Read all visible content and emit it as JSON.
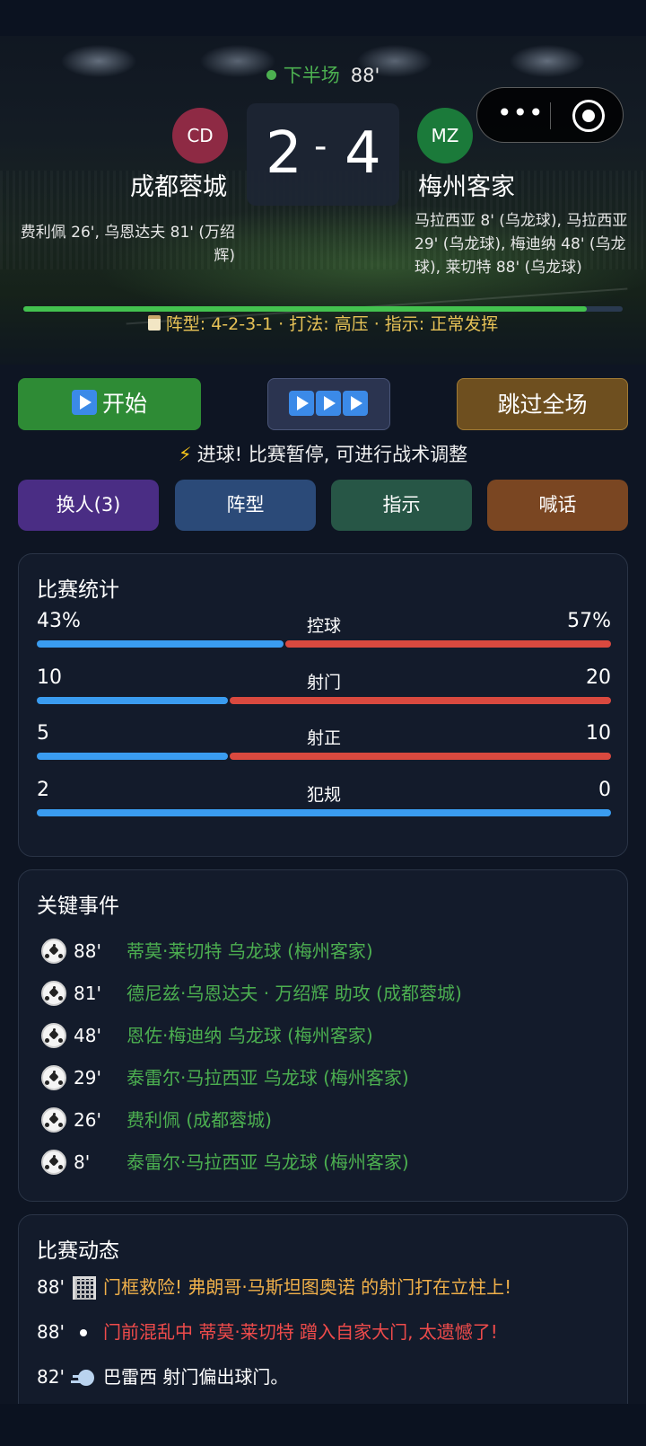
{
  "match": {
    "period_label": "下半场",
    "minute": "88'",
    "home": {
      "abbr": "CD",
      "name": "成都蓉城",
      "score": "2",
      "color": "#8e2a44",
      "scorers": "费利佩 26', 乌恩达夫 81' (万绍辉)"
    },
    "away": {
      "abbr": "MZ",
      "name": "梅州客家",
      "score": "4",
      "color": "#1b7a3a",
      "scorers": "马拉西亚 8' (乌龙球), 马拉西亚 29' (乌龙球), 梅迪纳 48' (乌龙球), 莱切特 88' (乌龙球)"
    },
    "score_separator": "-",
    "progress_fraction": 0.94,
    "tactics": "阵型: 4-2-3-1 · 打法: 高压 · 指示: 正常发挥"
  },
  "controls": {
    "start_label": "开始",
    "skip_label": "跳过全场",
    "notice": "进球! 比赛暂停, 可进行战术调整",
    "tactic_buttons": {
      "sub": "换人(3)",
      "formation": "阵型",
      "instructions": "指示",
      "shout": "喊话"
    }
  },
  "stats": {
    "title": "比赛统计",
    "rows": [
      {
        "name": "控球",
        "home": "43%",
        "away": "57%",
        "home_fraction": 0.43
      },
      {
        "name": "射门",
        "home": "10",
        "away": "20",
        "home_fraction": 0.333
      },
      {
        "name": "射正",
        "home": "5",
        "away": "10",
        "home_fraction": 0.333
      },
      {
        "name": "犯规",
        "home": "2",
        "away": "0",
        "home_fraction": 1.0
      }
    ]
  },
  "events": {
    "title": "关键事件",
    "items": [
      {
        "minute": "88'",
        "text": "蒂莫·莱切特 乌龙球 (梅州客家)"
      },
      {
        "minute": "81'",
        "text": "德尼兹·乌恩达夫 · 万绍辉 助攻 (成都蓉城)"
      },
      {
        "minute": "48'",
        "text": "恩佐·梅迪纳 乌龙球 (梅州客家)"
      },
      {
        "minute": "29'",
        "text": "泰雷尔·马拉西亚 乌龙球 (梅州客家)"
      },
      {
        "minute": "26'",
        "text": "费利佩 (成都蓉城)"
      },
      {
        "minute": "8'",
        "text": "泰雷尔·马拉西亚 乌龙球 (梅州客家)"
      }
    ]
  },
  "feed": {
    "title": "比赛动态",
    "items": [
      {
        "minute": "88'",
        "icon": "goalpost-icon",
        "text": "门框救险! 弗朗哥·马斯坦图奥诺 的射门打在立柱上!",
        "color": "#f0b04a"
      },
      {
        "minute": "88'",
        "icon": "dot-icon",
        "text": "门前混乱中 蒂莫·莱切特 蹭入自家大门, 太遗憾了!",
        "color": "#ef4b4b"
      },
      {
        "minute": "82'",
        "icon": "wind-icon",
        "text": "巴雷西 射门偏出球门。",
        "color": "#ffffff"
      }
    ]
  },
  "colors": {
    "accent_green": "#4caf50",
    "home_bar": "#3a9cf0",
    "away_bar": "#d9493f",
    "tactics_text": "#e8c357"
  }
}
